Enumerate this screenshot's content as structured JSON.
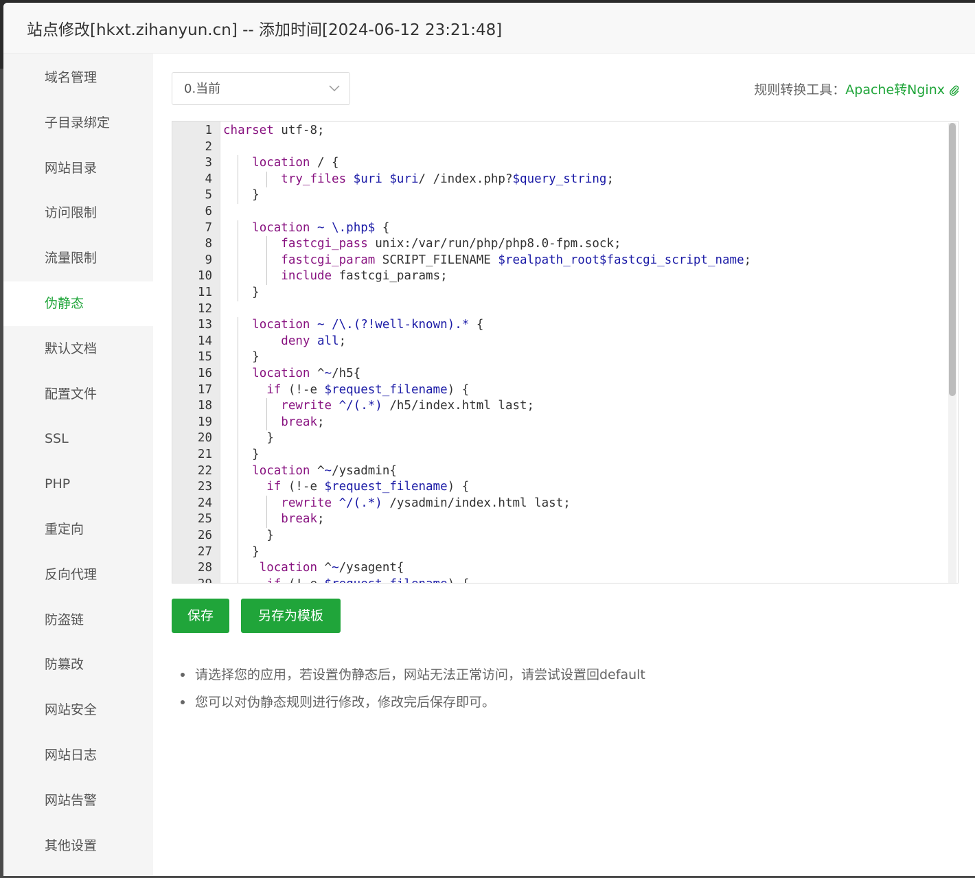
{
  "title": "站点修改[hkxt.zihanyun.cn] -- 添加时间[2024-06-12 23:21:48]",
  "sidebar": {
    "items": [
      {
        "label": "域名管理"
      },
      {
        "label": "子目录绑定"
      },
      {
        "label": "网站目录"
      },
      {
        "label": "访问限制"
      },
      {
        "label": "流量限制"
      },
      {
        "label": "伪静态",
        "active": true
      },
      {
        "label": "默认文档"
      },
      {
        "label": "配置文件"
      },
      {
        "label": "SSL"
      },
      {
        "label": "PHP"
      },
      {
        "label": "重定向"
      },
      {
        "label": "反向代理"
      },
      {
        "label": "防盗链"
      },
      {
        "label": "防篡改"
      },
      {
        "label": "网站安全"
      },
      {
        "label": "网站日志"
      },
      {
        "label": "网站告警"
      },
      {
        "label": "其他设置"
      }
    ]
  },
  "rewrite": {
    "select_value": "0.当前",
    "tool_label": "规则转换工具：",
    "tool_link": "Apache转Nginx",
    "code_lines": [
      "charset utf-8;",
      "",
      "    location / {",
      "        try_files $uri $uri/ /index.php?$query_string;",
      "    }",
      "",
      "    location ~ \\.php$ {",
      "        fastcgi_pass unix:/var/run/php/php8.0-fpm.sock;",
      "        fastcgi_param SCRIPT_FILENAME $realpath_root$fastcgi_script_name;",
      "        include fastcgi_params;",
      "    }",
      "",
      "    location ~ /\\.(?!well-known).* {",
      "        deny all;",
      "    }",
      "    location ^~/h5{",
      "      if (!-e $request_filename) {",
      "        rewrite ^/(.*) /h5/index.html last;",
      "        break;",
      "      }",
      "    }",
      "    location ^~/ysadmin{",
      "      if (!-e $request_filename) {",
      "        rewrite ^/(.*) /ysadmin/index.html last;",
      "        break;",
      "      }",
      "    }",
      "     location ^~/ysagent{",
      "      if (!-e $request_filename) {"
    ],
    "save_label": "保存",
    "save_template_label": "另存为模板",
    "tips": [
      "请选择您的应用，若设置伪静态后，网站无法正常访问，请尝试设置回default",
      "您可以对伪静态规则进行修改，修改完后保存即可。"
    ]
  },
  "colors": {
    "accent": "#20a53a",
    "keyword": "#881280",
    "variable": "#1a1aa6"
  },
  "icons": {
    "select_arrow": "chevron-down-icon",
    "tool_link": "paperclip-icon"
  }
}
